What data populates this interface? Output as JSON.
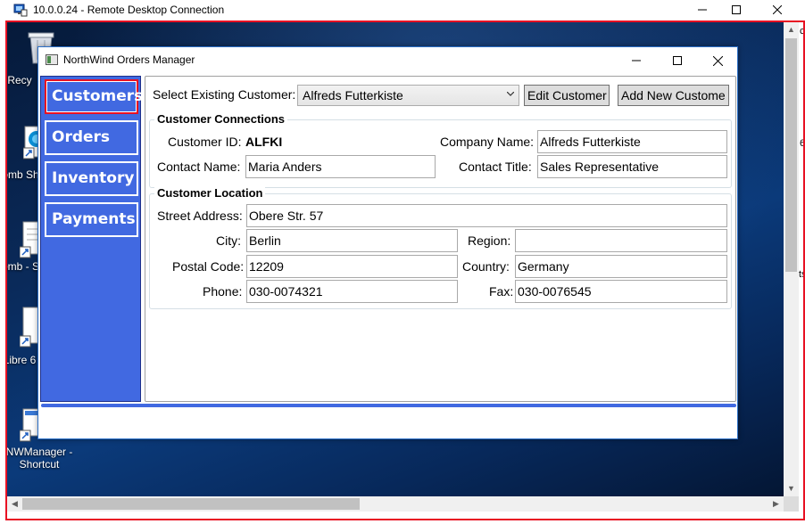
{
  "rdp": {
    "title": "10.0.0.24 - Remote Desktop Connection",
    "minimize": "—",
    "maximize": "☐",
    "close": "✕"
  },
  "desktop": {
    "icons": [
      {
        "label": "Recy"
      },
      {
        "label": "Comb Sho"
      },
      {
        "label": "Comb - Sh"
      },
      {
        "label": "Libre 6"
      },
      {
        "label": "NWManager - Shortcut"
      }
    ],
    "right_edge": [
      "c",
      "6",
      "ts"
    ]
  },
  "app": {
    "title": "NorthWind Orders Manager",
    "nav": {
      "customers": "Customers",
      "orders": "Orders",
      "inventory": "Inventory",
      "payments": "Payments"
    },
    "select_label": "Select Existing Customer:",
    "select_value": "Alfreds Futterkiste",
    "edit_button": "Edit Customer",
    "add_button": "Add New Custome",
    "connections": {
      "title": "Customer Connections",
      "customer_id_label": "Customer ID:",
      "customer_id": "ALFKI",
      "company_name_label": "Company Name:",
      "company_name": "Alfreds Futterkiste",
      "contact_name_label": "Contact Name:",
      "contact_name": "Maria Anders",
      "contact_title_label": "Contact Title:",
      "contact_title": "Sales Representative"
    },
    "location": {
      "title": "Customer Location",
      "street_label": "Street Address:",
      "street": "Obere Str. 57",
      "city_label": "City:",
      "city": "Berlin",
      "region_label": "Region:",
      "region": "",
      "postal_label": "Postal Code:",
      "postal": "12209",
      "country_label": "Country:",
      "country": "Germany",
      "phone_label": "Phone:",
      "phone": "030-0074321",
      "fax_label": "Fax:",
      "fax": "030-0076545"
    }
  },
  "colors": {
    "nav_bg": "#4169e1",
    "active_border": "#e81123",
    "rdp_border": "#e81123"
  }
}
